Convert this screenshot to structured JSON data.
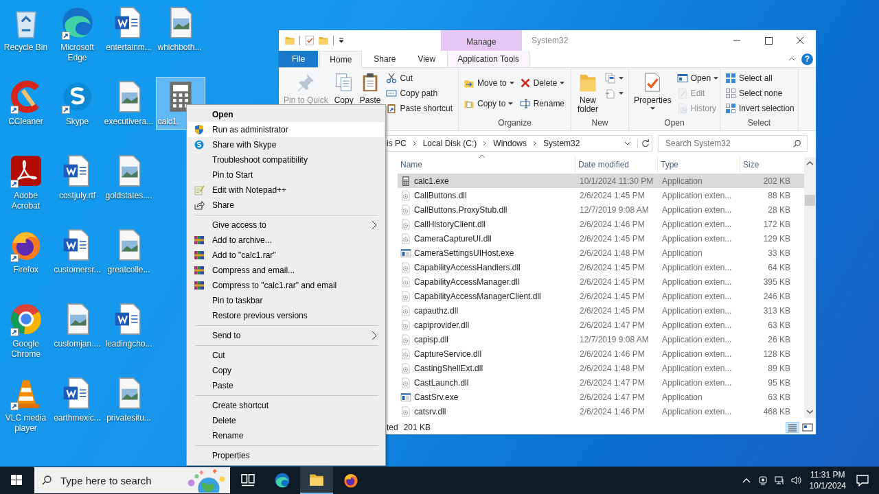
{
  "desktop": {
    "columns": [
      [
        {
          "label": "Recycle Bin",
          "kind": "recycle-bin",
          "shortcut": false,
          "selected": false
        },
        {
          "label": "CCleaner",
          "kind": "broom",
          "shortcut": true,
          "selected": false
        },
        {
          "label": "Adobe Acrobat",
          "kind": "pdf",
          "shortcut": true,
          "selected": false
        },
        {
          "label": "Firefox",
          "kind": "fox-globe",
          "shortcut": true,
          "selected": false
        },
        {
          "label": "Google Chrome",
          "kind": "tricolor",
          "shortcut": true,
          "selected": false
        },
        {
          "label": "VLC media player",
          "kind": "cone",
          "shortcut": true,
          "selected": false
        }
      ],
      [
        {
          "label": "Microsoft Edge",
          "kind": "swirl",
          "shortcut": true,
          "selected": false
        },
        {
          "label": "Skype",
          "kind": "bubble",
          "shortcut": true,
          "selected": false
        },
        {
          "label": "costjuly.rtf",
          "kind": "document",
          "shortcut": false,
          "selected": false
        },
        {
          "label": "customersr...",
          "kind": "document",
          "shortcut": false,
          "selected": false
        },
        {
          "label": "customjan....",
          "kind": "image-file",
          "shortcut": false,
          "selected": false
        },
        {
          "label": "earthmexic...",
          "kind": "document",
          "shortcut": false,
          "selected": false
        }
      ],
      [
        {
          "label": "entertainm...",
          "kind": "document",
          "shortcut": false,
          "selected": false
        },
        {
          "label": "executivera...",
          "kind": "image-file",
          "shortcut": false,
          "selected": false
        },
        {
          "label": "goldstates....",
          "kind": "image-file",
          "shortcut": false,
          "selected": false
        },
        {
          "label": "greatcolle...",
          "kind": "image-file",
          "shortcut": false,
          "selected": false
        },
        {
          "label": "leadingcho...",
          "kind": "document",
          "shortcut": false,
          "selected": false
        },
        {
          "label": "privatesitu...",
          "kind": "image-file",
          "shortcut": false,
          "selected": false
        }
      ],
      [
        {
          "label": "whichboth...",
          "kind": "image-file",
          "shortcut": false,
          "selected": false
        },
        {
          "label": "calc1.",
          "kind": "calculator",
          "shortcut": false,
          "selected": true
        }
      ]
    ]
  },
  "explorer": {
    "contextual_group": "Manage",
    "title": "System32",
    "help": "?",
    "tabs": [
      {
        "label": "File",
        "kind": "file",
        "selected": false
      },
      {
        "label": "Home",
        "kind": "plain",
        "selected": true
      },
      {
        "label": "Share",
        "kind": "plain",
        "selected": false
      },
      {
        "label": "View",
        "kind": "plain",
        "selected": false
      },
      {
        "label": "Application Tools",
        "kind": "contextual",
        "selected": false
      }
    ],
    "ribbon": [
      {
        "items": [
          {
            "label": "Pin to Quick",
            "kind": "pin",
            "disabled": true
          },
          {
            "label": "Copy",
            "kind": "copy",
            "disabled": false
          },
          {
            "label": "Paste",
            "kind": "clipboard",
            "disabled": false
          },
          {
            "buttons": [
              {
                "label": "Cut",
                "kind": "scissors",
                "disabled": false,
                "dropdown": false
              },
              {
                "label": "Copy path",
                "kind": "path",
                "disabled": false,
                "dropdown": false
              },
              {
                "label": "Paste shortcut",
                "kind": "paste-shortcut",
                "disabled": false,
                "dropdown": false
              }
            ]
          }
        ]
      },
      {
        "label": "Organize",
        "items": [
          {
            "buttons": [
              {
                "label": "Move to",
                "kind": "move",
                "disabled": false,
                "dropdown": true
              },
              {
                "label": "Copy to",
                "kind": "copy-to",
                "disabled": false,
                "dropdown": true
              }
            ]
          },
          {
            "buttons": [
              {
                "label": "Delete",
                "kind": "cross",
                "disabled": false,
                "dropdown": true
              },
              {
                "label": "Rename",
                "kind": "rename",
                "disabled": false,
                "dropdown": false
              }
            ]
          }
        ]
      },
      {
        "label": "New",
        "items": [
          {
            "label": "New folder",
            "kind": "new-folder",
            "disabled": false,
            "dropdown": false
          },
          {
            "buttons": [
              {
                "kind": "new-item",
                "disabled": false,
                "dropdown": true
              },
              {
                "kind": "easy-access",
                "disabled": false,
                "dropdown": true
              }
            ]
          }
        ]
      },
      {
        "label": "Open",
        "items": [
          {
            "label": "Properties",
            "kind": "properties",
            "disabled": false,
            "dropdown": true
          },
          {
            "buttons": [
              {
                "label": "Open",
                "kind": "open",
                "disabled": false,
                "dropdown": true
              },
              {
                "label": "Edit",
                "kind": "edit",
                "disabled": true,
                "dropdown": false
              },
              {
                "label": "History",
                "kind": "history",
                "disabled": true,
                "dropdown": false
              }
            ]
          }
        ]
      },
      {
        "label": "Select",
        "items": [
          {
            "buttons": [
              {
                "label": "Select all",
                "kind": "select-all",
                "disabled": false,
                "dropdown": false
              },
              {
                "label": "Select none",
                "kind": "select-none",
                "disabled": false,
                "dropdown": false
              },
              {
                "label": "Invert selection",
                "kind": "invert",
                "disabled": false,
                "dropdown": false
              }
            ]
          }
        ]
      }
    ],
    "address": [
      "is PC",
      "Local Disk (C:)",
      "Windows",
      "System32"
    ],
    "search": {
      "placeholder": "Search System32"
    },
    "columns": [
      {
        "label": "Name",
        "sorted": true
      },
      {
        "label": "Date modified",
        "sorted": false
      },
      {
        "label": "Type",
        "sorted": false
      },
      {
        "label": "Size",
        "sorted": false
      }
    ],
    "files": [
      {
        "name": "calc1.exe",
        "kind": "calculator",
        "date": "10/1/2024 11:30 PM",
        "type": "Application",
        "size": "202 KB",
        "selected": true
      },
      {
        "name": "CallButtons.dll",
        "kind": "dll",
        "date": "2/6/2024 1:45 PM",
        "type": "Application exten...",
        "size": "88 KB",
        "selected": false
      },
      {
        "name": "CallButtons.ProxyStub.dll",
        "kind": "dll",
        "date": "12/7/2019 9:08 AM",
        "type": "Application exten...",
        "size": "28 KB",
        "selected": false
      },
      {
        "name": "CallHistoryClient.dll",
        "kind": "dll",
        "date": "2/6/2024 1:46 PM",
        "type": "Application exten...",
        "size": "172 KB",
        "selected": false
      },
      {
        "name": "CameraCaptureUI.dll",
        "kind": "dll",
        "date": "2/6/2024 1:45 PM",
        "type": "Application exten...",
        "size": "129 KB",
        "selected": false
      },
      {
        "name": "CameraSettingsUIHost.exe",
        "kind": "app-window",
        "date": "2/6/2024 1:48 PM",
        "type": "Application",
        "size": "33 KB",
        "selected": false
      },
      {
        "name": "CapabilityAccessHandlers.dll",
        "kind": "dll",
        "date": "2/6/2024 1:45 PM",
        "type": "Application exten...",
        "size": "64 KB",
        "selected": false
      },
      {
        "name": "CapabilityAccessManager.dll",
        "kind": "dll",
        "date": "2/6/2024 1:45 PM",
        "type": "Application exten...",
        "size": "395 KB",
        "selected": false
      },
      {
        "name": "CapabilityAccessManagerClient.dll",
        "kind": "dll",
        "date": "2/6/2024 1:45 PM",
        "type": "Application exten...",
        "size": "246 KB",
        "selected": false
      },
      {
        "name": "capauthz.dll",
        "kind": "dll",
        "date": "2/6/2024 1:45 PM",
        "type": "Application exten...",
        "size": "313 KB",
        "selected": false
      },
      {
        "name": "capiprovider.dll",
        "kind": "dll",
        "date": "2/6/2024 1:47 PM",
        "type": "Application exten...",
        "size": "63 KB",
        "selected": false
      },
      {
        "name": "capisp.dll",
        "kind": "dll",
        "date": "12/7/2019 9:08 AM",
        "type": "Application exten...",
        "size": "26 KB",
        "selected": false
      },
      {
        "name": "CaptureService.dll",
        "kind": "dll",
        "date": "2/6/2024 1:46 PM",
        "type": "Application exten...",
        "size": "128 KB",
        "selected": false
      },
      {
        "name": "CastingShellExt.dll",
        "kind": "dll",
        "date": "2/6/2024 1:48 PM",
        "type": "Application exten...",
        "size": "89 KB",
        "selected": false
      },
      {
        "name": "CastLaunch.dll",
        "kind": "dll",
        "date": "2/6/2024 1:47 PM",
        "type": "Application exten...",
        "size": "95 KB",
        "selected": false
      },
      {
        "name": "CastSrv.exe",
        "kind": "app-window",
        "date": "2/6/2024 1:47 PM",
        "type": "Application",
        "size": "63 KB",
        "selected": false
      },
      {
        "name": "catsrv.dll",
        "kind": "dll",
        "date": "2/6/2024 1:46 PM",
        "type": "Application exten...",
        "size": "468 KB",
        "selected": false
      }
    ],
    "status": [
      "ted",
      "201 KB"
    ],
    "views": [
      {
        "kind": "details",
        "selected": true
      },
      {
        "kind": "tiles",
        "selected": false
      }
    ]
  },
  "context_menu": [
    [
      {
        "label": "Open",
        "kind": "plain",
        "default": true,
        "submenu": false,
        "selected": false
      },
      {
        "label": "Run as administrator",
        "kind": "shield",
        "default": false,
        "submenu": false,
        "selected": true
      },
      {
        "label": "Share with Skype",
        "kind": "bubble",
        "default": false,
        "submenu": false,
        "selected": false
      },
      {
        "label": "Troubleshoot compatibility",
        "kind": "plain",
        "default": false,
        "submenu": false,
        "selected": false
      },
      {
        "label": "Pin to Start",
        "kind": "plain",
        "default": false,
        "submenu": false,
        "selected": false
      },
      {
        "label": "Edit with Notepad++",
        "kind": "notepad",
        "default": false,
        "submenu": false,
        "selected": false
      },
      {
        "label": "Share",
        "kind": "share",
        "default": false,
        "submenu": false,
        "selected": false
      }
    ],
    [
      {
        "label": "Give access to",
        "kind": "plain",
        "default": false,
        "submenu": true,
        "selected": false
      },
      {
        "label": "Add to archive...",
        "kind": "books",
        "default": false,
        "submenu": false,
        "selected": false
      },
      {
        "label": "Add to \"calc1.rar\"",
        "kind": "books",
        "default": false,
        "submenu": false,
        "selected": false
      },
      {
        "label": "Compress and email...",
        "kind": "books",
        "default": false,
        "submenu": false,
        "selected": false
      },
      {
        "label": "Compress to \"calc1.rar\" and email",
        "kind": "books",
        "default": false,
        "submenu": false,
        "selected": false
      },
      {
        "label": "Pin to taskbar",
        "kind": "plain",
        "default": false,
        "submenu": false,
        "selected": false
      },
      {
        "label": "Restore previous versions",
        "kind": "plain",
        "default": false,
        "submenu": false,
        "selected": false
      }
    ],
    [
      {
        "label": "Send to",
        "kind": "plain",
        "default": false,
        "submenu": true,
        "selected": false
      }
    ],
    [
      {
        "label": "Cut",
        "kind": "plain",
        "default": false,
        "submenu": false,
        "selected": false
      },
      {
        "label": "Copy",
        "kind": "plain",
        "default": false,
        "submenu": false,
        "selected": false
      },
      {
        "label": "Paste",
        "kind": "plain",
        "default": false,
        "submenu": false,
        "selected": false
      }
    ],
    [
      {
        "label": "Create shortcut",
        "kind": "plain",
        "default": false,
        "submenu": false,
        "selected": false
      },
      {
        "label": "Delete",
        "kind": "plain",
        "default": false,
        "submenu": false,
        "selected": false
      },
      {
        "label": "Rename",
        "kind": "plain",
        "default": false,
        "submenu": false,
        "selected": false
      }
    ],
    [
      {
        "label": "Properties",
        "kind": "plain",
        "default": false,
        "submenu": false,
        "selected": false
      }
    ]
  ],
  "taskbar": {
    "search": {
      "placeholder": "Type here to search"
    },
    "apps": [
      {
        "kind": "task-view",
        "active": false
      },
      {
        "kind": "swirl",
        "active": false
      },
      {
        "kind": "folder",
        "active": true
      },
      {
        "kind": "fox-globe",
        "active": false
      }
    ],
    "time": "11:31 PM",
    "date": "10/1/2024"
  }
}
